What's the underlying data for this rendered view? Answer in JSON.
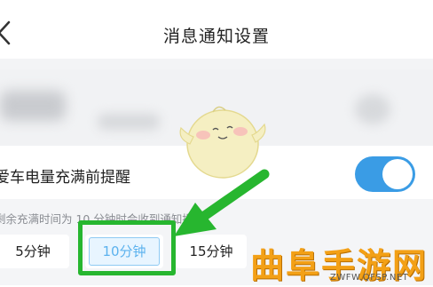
{
  "header": {
    "title": "消息通知设置",
    "back_icon": "chevron-left-icon"
  },
  "setting": {
    "label": "爱车电量充满前提醒",
    "toggle_on": true,
    "toggle_color": "#3a9ce5"
  },
  "hint": {
    "text": "剩余充满时间为 10 分钟时会收到通知提醒"
  },
  "options": [
    {
      "label": "5分钟",
      "selected": false
    },
    {
      "label": "10分钟",
      "selected": true
    },
    {
      "label": "15分钟",
      "selected": false
    }
  ],
  "annotation": {
    "highlight_color": "#27b62f"
  },
  "watermark": {
    "brand": "曲阜手游网",
    "url": "ZWFW.QFSP.NET"
  }
}
